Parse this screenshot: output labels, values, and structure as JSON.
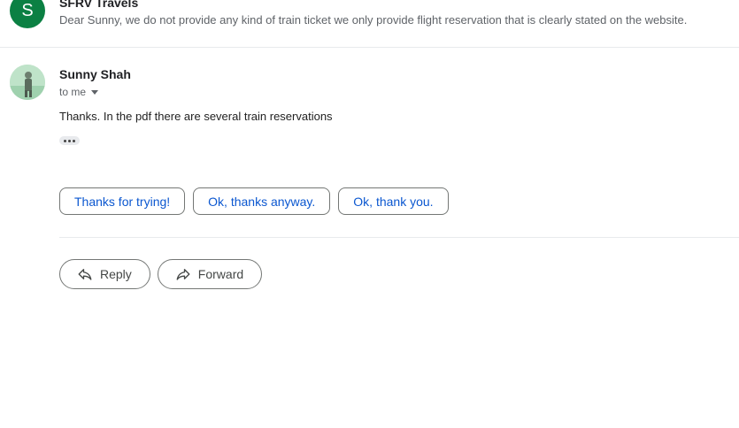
{
  "previous_message": {
    "avatar_letter": "S",
    "avatar_color": "#0b8043",
    "sender": "SFRV Travels",
    "snippet": "Dear Sunny, we do not provide any kind of train ticket we only provide flight reservation that is clearly stated on the website."
  },
  "message": {
    "sender": "Sunny Shah",
    "recipient": "to me",
    "body": "Thanks. In the pdf there are several train reservations"
  },
  "smart_replies": [
    "Thanks for trying!",
    "Ok, thanks anyway.",
    "Ok, thank you."
  ],
  "actions": {
    "reply_label": "Reply",
    "forward_label": "Forward",
    "reply_icon": "reply-arrow-icon",
    "forward_icon": "forward-arrow-icon"
  },
  "colors": {
    "chip_text": "#0b57d0",
    "border": "#747775",
    "divider": "#e8eaed"
  }
}
